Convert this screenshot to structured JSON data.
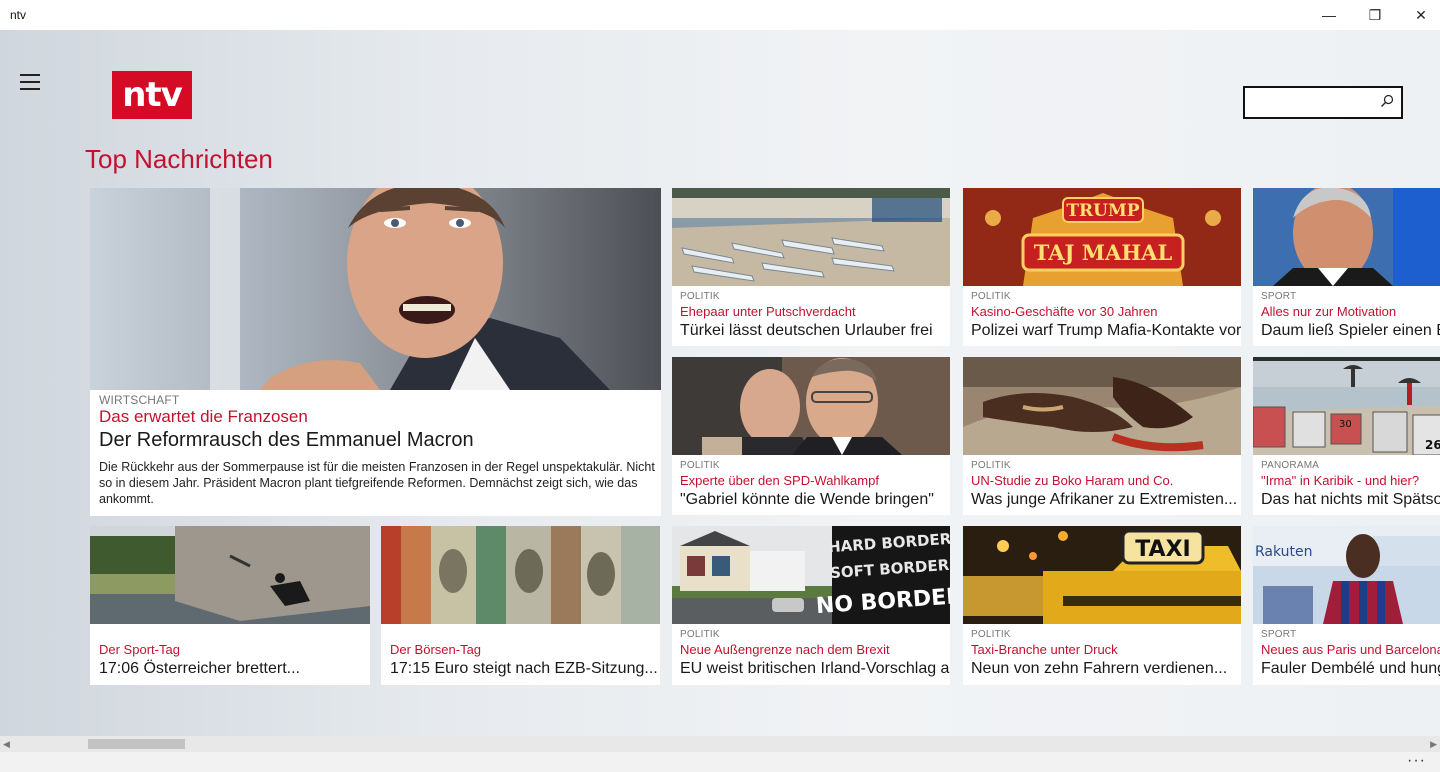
{
  "window": {
    "title": "ntv",
    "minimize_glyph": "—",
    "maximize_glyph": "❐",
    "close_glyph": "✕"
  },
  "header": {
    "logo_text": "ntv",
    "search_placeholder": "",
    "section_title": "Top Nachrichten"
  },
  "colors": {
    "brand_red": "#d50a25",
    "kicker_red": "#c4112f"
  },
  "hero": {
    "category": "WIRTSCHAFT",
    "kicker": "Das erwartet die Franzosen",
    "headline": "Der Reformrausch des Emmanuel Macron",
    "summary": "Die Rückkehr aus der Sommerpause ist für die meisten Franzosen in der Regel unspektakulär. Nicht so in diesem Jahr. Präsident Macron plant tiefgreifende Reformen. Demnächst zeigt sich, wie das ankommt."
  },
  "cards": [
    {
      "category": "POLITIK",
      "kicker": "Ehepaar unter Putschverdacht",
      "headline": "Türkei lässt deutschen Urlauber frei"
    },
    {
      "category": "POLITIK",
      "kicker": "Kasino-Geschäfte vor 30 Jahren",
      "headline": "Polizei warf Trump Mafia-Kontakte vor"
    },
    {
      "category": "SPORT",
      "kicker": "Alles nur zur Motivation",
      "headline": "Daum ließ Spieler einen Bu"
    },
    {
      "category": "POLITIK",
      "kicker": "Experte über den SPD-Wahlkampf",
      "headline": "\"Gabriel könnte die Wende bringen\""
    },
    {
      "category": "POLITIK",
      "kicker": "UN-Studie zu Boko Haram und Co.",
      "headline": "Was junge Afrikaner zu Extremisten..."
    },
    {
      "category": "PANORAMA",
      "kicker": "\"Irma\" in Karibik - und hier?",
      "headline": "Das hat nichts mit Spätsom"
    },
    {
      "category": "",
      "kicker": "Der Sport-Tag",
      "headline": "17:06 Österreicher brettert..."
    },
    {
      "category": "",
      "kicker": "Der Börsen-Tag",
      "headline": "17:15 Euro steigt nach EZB-Sitzung..."
    },
    {
      "category": "POLITIK",
      "kicker": "Neue Außengrenze nach dem Brexit",
      "headline": "EU weist britischen Irland-Vorschlag ab"
    },
    {
      "category": "POLITIK",
      "kicker": "Taxi-Branche unter Druck",
      "headline": "Neun von zehn Fahrern verdienen..."
    },
    {
      "category": "SPORT",
      "kicker": "Neues aus Paris und Barcelona",
      "headline": "Fauler Dembélé und hungri"
    }
  ],
  "image_text": {
    "trump_sign_top": "TRUMP",
    "trump_sign_bottom": "TAJ MAHAL",
    "border_sign": [
      "HARD BORDER",
      "SOFT BORDER",
      "NO BORDER"
    ],
    "taxi_sign": "TAXI",
    "beach_numbers": [
      "30",
      "26"
    ],
    "jersey_sponsor": "Rakuten"
  },
  "appbar": {
    "more": "···"
  }
}
